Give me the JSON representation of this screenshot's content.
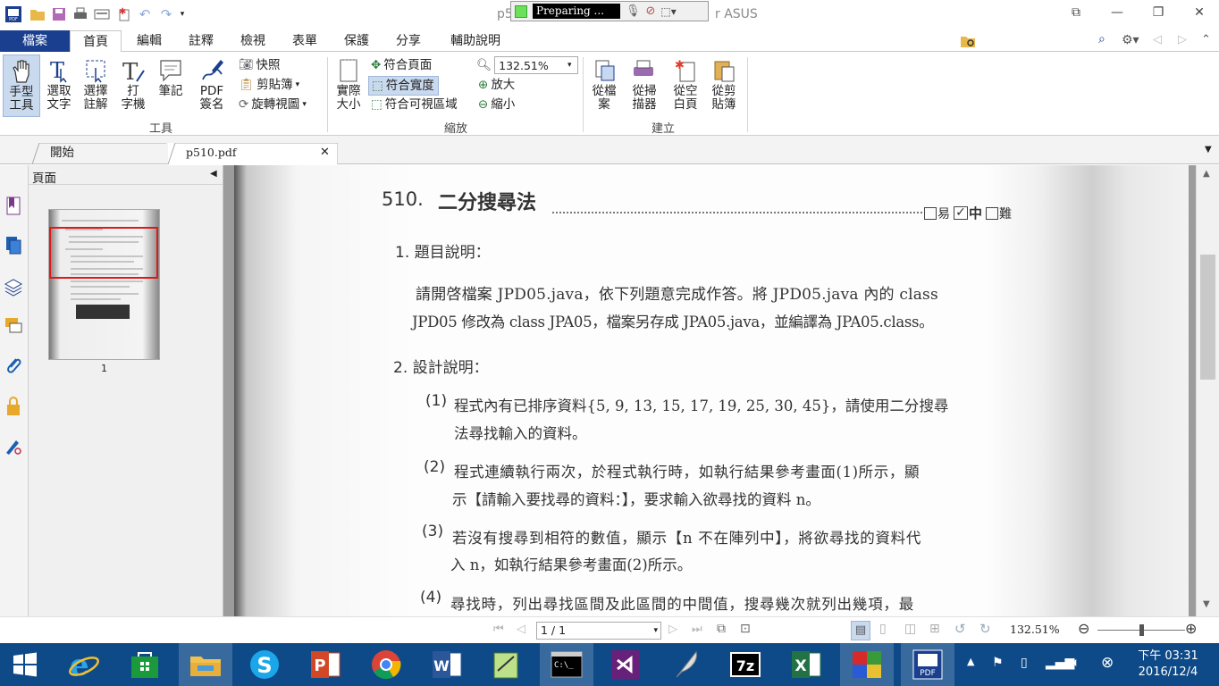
{
  "window": {
    "title_left": "p5",
    "title_right": "r ASUS",
    "recorder_status": "Preparing ...",
    "controls": [
      "restore-grid-icon",
      "minimize-icon",
      "maximize-icon",
      "close-icon"
    ]
  },
  "menu": {
    "tabs": [
      "檔案",
      "首頁",
      "編輯",
      "註釋",
      "檢視",
      "表單",
      "保護",
      "分享",
      "輔助說明"
    ],
    "search_value": "尋找"
  },
  "ribbon": {
    "tools": {
      "hand": "手型\n工具",
      "select_text": "選取\n文字",
      "select_annot": "選擇\n註解",
      "typewriter": "打\n字機",
      "note": "筆記",
      "pdf_sign": "PDF\n簽名",
      "snapshot": "快照",
      "clipboard": "剪貼簿",
      "rotate": "旋轉視圖",
      "group_label": "工具"
    },
    "zoom": {
      "actual_size": "實際\n大小",
      "fit_page": "符合頁面",
      "fit_width": "符合寬度",
      "fit_visible": "符合可視區域",
      "zoom_value": "132.51%",
      "zoom_in": "放大",
      "zoom_out": "縮小",
      "group_label": "縮放"
    },
    "create": {
      "from_file": "從檔\n案",
      "from_scanner": "從掃\n描器",
      "from_blank": "從空\n白頁",
      "from_clipboard": "從剪\n貼簿",
      "group_label": "建立"
    }
  },
  "doc_tabs": [
    "開始",
    "p510.pdf"
  ],
  "pages_panel": {
    "title": "頁面",
    "thumb_label": "1"
  },
  "document": {
    "heading_no": "510.",
    "heading": "二分搜尋法",
    "difficulty": [
      "易",
      "中",
      "難"
    ],
    "difficulty_checked": "中",
    "s1_title": "1. 題目說明：",
    "s1_line1": "請開啓檔案 JPD05.java，依下列題意完成作答。將 JPD05.java 內的 class",
    "s1_line2": "JPD05 修改為 class JPA05，檔案另存成 JPA05.java，並編譯為 JPA05.class。",
    "s2_title": "2. 設計說明：",
    "items": [
      {
        "num": "(1)",
        "line1": "程式內有已排序資料{5, 9, 13, 15, 17, 19, 25, 30, 45}，請使用二分搜尋",
        "line2": "法尋找輸入的資料。"
      },
      {
        "num": "(2)",
        "line1": "程式連續執行兩次，於程式執行時，如執行結果參考畫面(1)所示，顯",
        "line2": "示【請輸入要找尋的資料：】，要求輸入欲尋找的資料 n。"
      },
      {
        "num": "(3)",
        "line1": "若沒有搜尋到相符的數值，顯示【n 不在陣列中】，將欲尋找的資料代",
        "line2": "入 n，如執行結果參考畫面(2)所示。"
      },
      {
        "num": "(4)",
        "line1": "尋找時，列出尋找區間及此區間的中間值，搜尋幾次就列出幾項，最",
        "line2": ""
      }
    ]
  },
  "statusbar": {
    "page_field": "1 / 1",
    "zoom": "132.51%",
    "zoom_level": 0.5
  },
  "taskbar": {
    "apps": [
      "start-icon",
      "ie-icon",
      "store-icon",
      "explorer-icon",
      "skype-icon",
      "powerpoint-icon",
      "chrome-icon",
      "word-icon",
      "notepad-icon",
      "cmd-icon",
      "visual-studio-icon",
      "quill-icon",
      "7zip-icon",
      "excel-icon",
      "winrar-icon",
      "pdf-reader-icon"
    ],
    "time": "下午 03:31",
    "date": "2016/12/4"
  }
}
